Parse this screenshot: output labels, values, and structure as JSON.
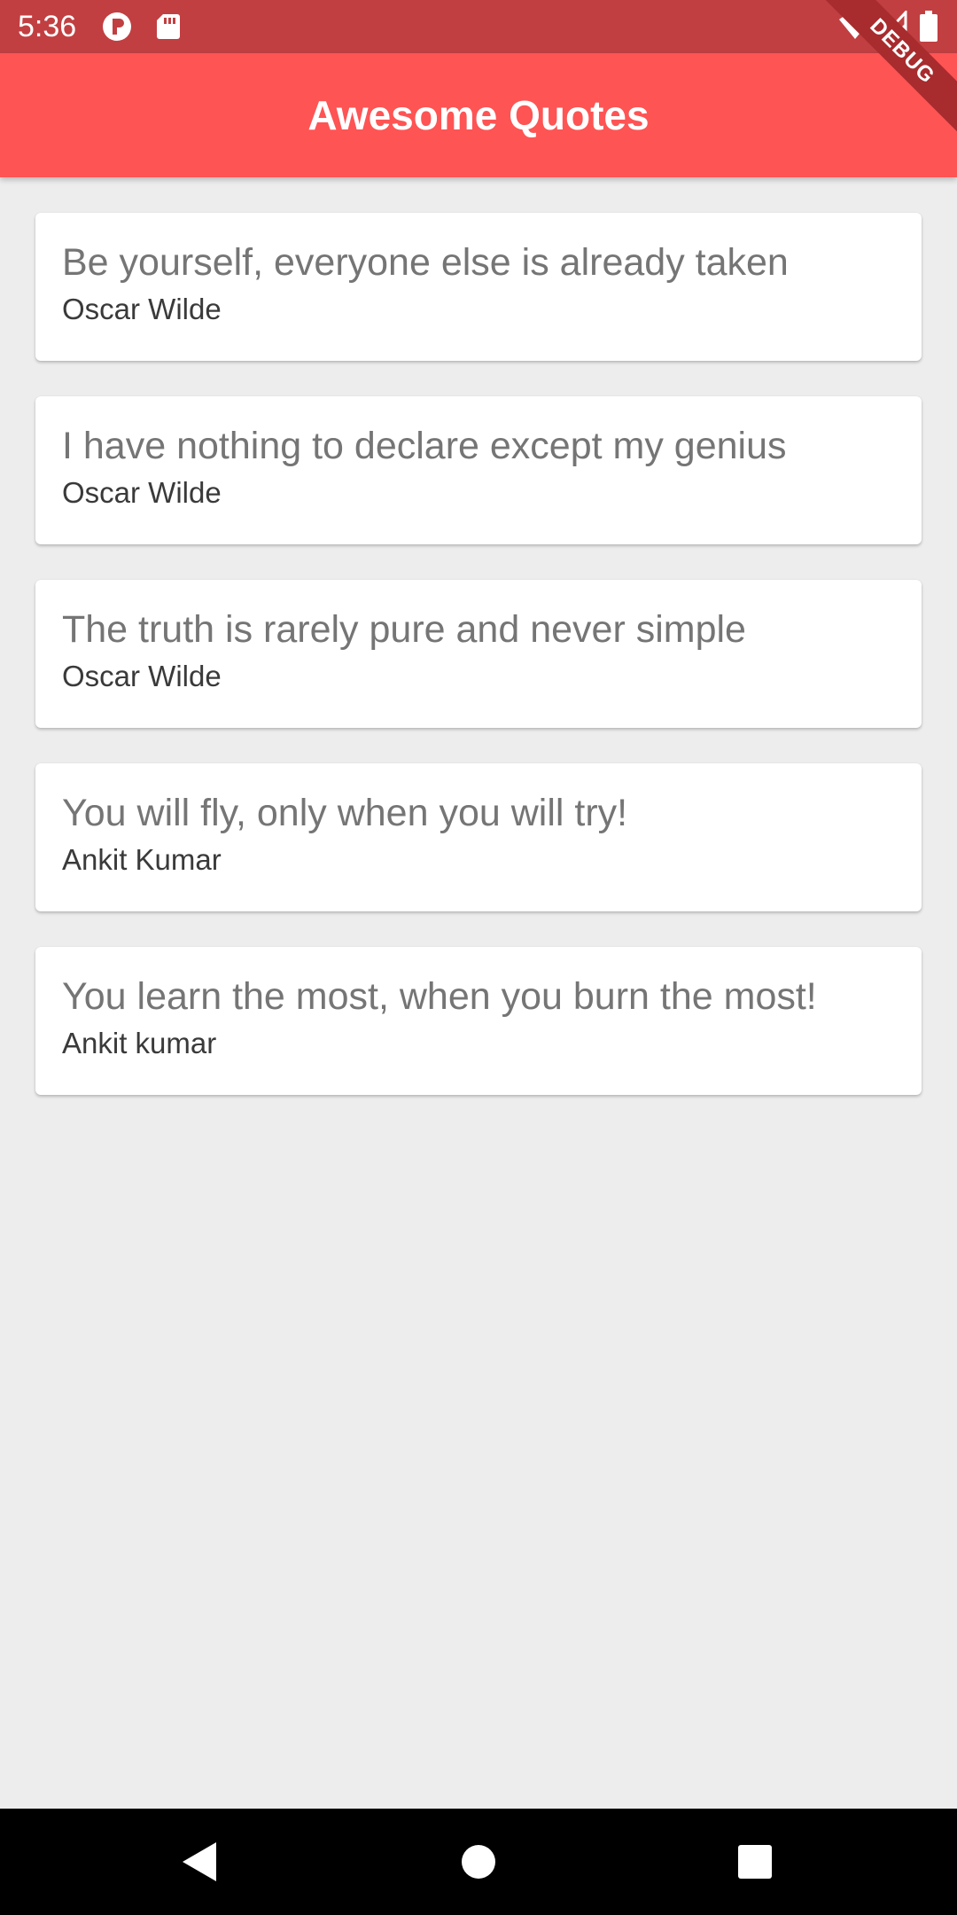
{
  "status_bar": {
    "time": "5:36",
    "icons": [
      "app-notification-icon",
      "sd-card-icon",
      "wifi-icon",
      "signal-icon",
      "battery-icon"
    ]
  },
  "debug_banner": {
    "label": "DEBUG"
  },
  "app_bar": {
    "title": "Awesome Quotes",
    "color": "#fe5454"
  },
  "quotes": [
    {
      "text": "Be yourself, everyone else is already taken",
      "author": "Oscar Wilde"
    },
    {
      "text": "I have nothing to declare except my genius",
      "author": "Oscar Wilde"
    },
    {
      "text": "The truth is rarely pure and never simple",
      "author": "Oscar Wilde"
    },
    {
      "text": "You will fly, only when you will try!",
      "author": "Ankit Kumar"
    },
    {
      "text": "You learn the most, when you burn the most!",
      "author": "Ankit kumar"
    }
  ],
  "nav_bar": {
    "buttons": [
      "back-icon",
      "home-icon",
      "recents-icon"
    ]
  },
  "colors": {
    "status_bar": "#c13f41",
    "background": "#ededed",
    "card": "#ffffff",
    "quote_text": "#757575",
    "author_text": "#3a3a3a"
  }
}
